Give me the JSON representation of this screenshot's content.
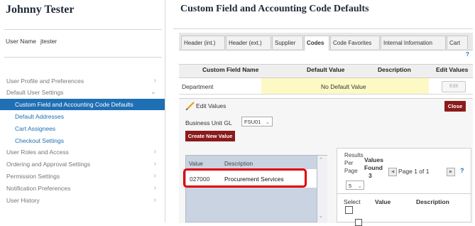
{
  "sidebar": {
    "user_display_name": "Johnny Tester",
    "username_label": "User Name",
    "username_value": "jtester",
    "items": [
      {
        "label": "User Profile and Preferences"
      },
      {
        "label": "Default User Settings"
      },
      {
        "label": "Custom Field and Accounting Code Defaults"
      },
      {
        "label": "Default Addresses"
      },
      {
        "label": "Cart Assignees"
      },
      {
        "label": "Checkout Settings"
      },
      {
        "label": "User Roles and Access"
      },
      {
        "label": "Ordering and Approval Settings"
      },
      {
        "label": "Permission Settings"
      },
      {
        "label": "Notification Preferences"
      },
      {
        "label": "User History"
      }
    ]
  },
  "main": {
    "title": "Custom Field and Accounting Code Defaults",
    "tabs": [
      {
        "label": "Header (int.)"
      },
      {
        "label": "Header (ext.)"
      },
      {
        "label": "Supplier"
      },
      {
        "label": "Codes"
      },
      {
        "label": "Code Favorites"
      },
      {
        "label": "Internal Information"
      },
      {
        "label": "Cart"
      }
    ],
    "help_mark": "?",
    "table": {
      "headers": [
        "Custom Field Name",
        "Default Value",
        "Description",
        "Edit Values"
      ],
      "rows": [
        {
          "field": "Department",
          "default_value": "No Default Value",
          "edit_label": "Edit"
        }
      ]
    },
    "edit_panel": {
      "edit_values_label": "Edit Values",
      "close_label": "Close",
      "bugl_label": "Business Unit GL",
      "bugl_value": "FSU01",
      "create_label": "Create New Value",
      "list_headers": [
        "Value",
        "Description"
      ],
      "list_rows": [
        {
          "value": "027000",
          "description": "Procurement Services"
        }
      ]
    },
    "results": {
      "results_per_page_label": "Results Per Page",
      "per_page_value": "5",
      "values_found_label": "Values Found",
      "values_found_count": "3",
      "page_text": "Page 1 of 1",
      "help_mark": "?",
      "col_select": "Select",
      "col_value": "Value",
      "col_description": "Description"
    }
  },
  "colors": {
    "accent_blue": "#1f6fb4",
    "button_maroon": "#8b1a1a",
    "highlight_red": "#e00000",
    "row_yellow": "#fdf9c4"
  }
}
